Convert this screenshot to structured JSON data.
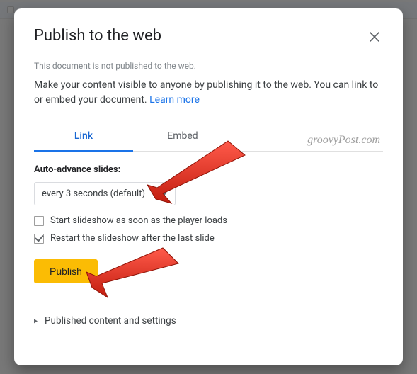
{
  "dialog": {
    "title": "Publish to the web",
    "status": "This document is not published to the web.",
    "description": "Make your content visible to anyone by publishing it to the web. You can link to or embed your document. ",
    "learn_more": "Learn more"
  },
  "tabs": {
    "link": "Link",
    "embed": "Embed",
    "active": "link"
  },
  "link_panel": {
    "auto_advance_label": "Auto-advance slides:",
    "auto_advance_value": "every 3 seconds (default)",
    "checkbox_start": {
      "label": "Start slideshow as soon as the player loads",
      "checked": false
    },
    "checkbox_restart": {
      "label": "Restart the slideshow after the last slide",
      "checked": true
    },
    "publish_button": "Publish"
  },
  "expand": {
    "label": "Published content and settings"
  },
  "watermark": "groovyPost.com"
}
